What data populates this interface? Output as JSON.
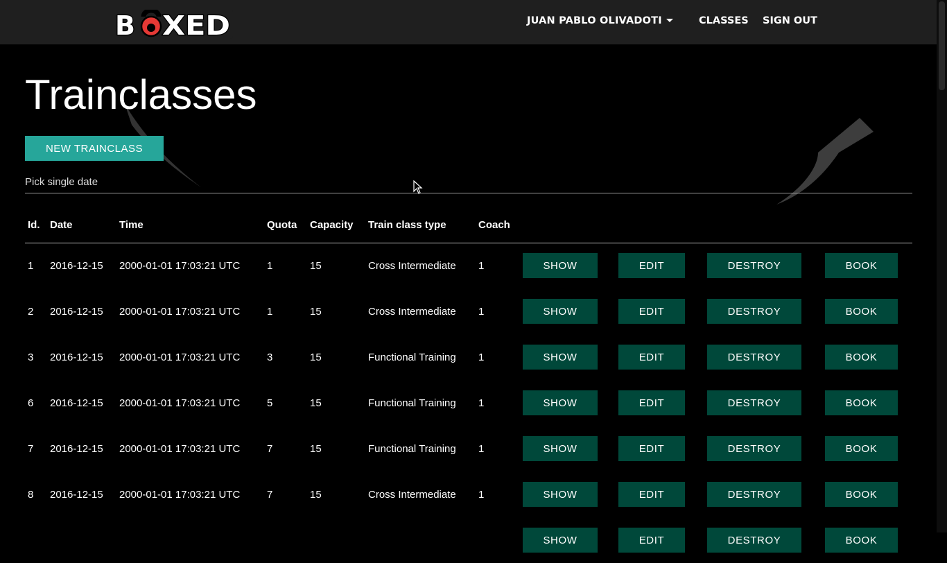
{
  "nav": {
    "logo_text": "BOXED",
    "user": "JUAN PABLO OLIVADOTI",
    "classes": "CLASSES",
    "sign_out": "SIGN OUT"
  },
  "page": {
    "title": "Trainclasses",
    "new_button": "NEW TRAINCLASS",
    "date_placeholder": "Pick single date"
  },
  "table": {
    "headers": [
      "Id.",
      "Date",
      "Time",
      "Quota",
      "Capacity",
      "Train class type",
      "Coach"
    ],
    "actions": [
      "SHOW",
      "EDIT",
      "DESTROY",
      "BOOK"
    ],
    "rows": [
      [
        "1",
        "2016-12-15",
        "2000-01-01 17:03:21 UTC",
        "1",
        "15",
        "Cross Intermediate",
        "1"
      ],
      [
        "2",
        "2016-12-15",
        "2000-01-01 17:03:21 UTC",
        "1",
        "15",
        "Cross Intermediate",
        "1"
      ],
      [
        "3",
        "2016-12-15",
        "2000-01-01 17:03:21 UTC",
        "3",
        "15",
        "Functional Training",
        "1"
      ],
      [
        "6",
        "2016-12-15",
        "2000-01-01 17:03:21 UTC",
        "5",
        "15",
        "Functional Training",
        "1"
      ],
      [
        "7",
        "2016-12-15",
        "2000-01-01 17:03:21 UTC",
        "7",
        "15",
        "Functional Training",
        "1"
      ],
      [
        "8",
        "2016-12-15",
        "2000-01-01 17:03:21 UTC",
        "7",
        "15",
        "Cross Intermediate",
        "1"
      ],
      [
        "",
        "",
        "",
        "",
        "",
        "",
        ""
      ]
    ]
  },
  "colors": {
    "navbar": "#1f1f1f",
    "primary_button": "#26a69a",
    "action_button": "#00483a",
    "kettlebell": "#e53935"
  },
  "icons": [
    "kettlebell-icon",
    "dropdown-caret-icon",
    "mouse-cursor-icon"
  ]
}
